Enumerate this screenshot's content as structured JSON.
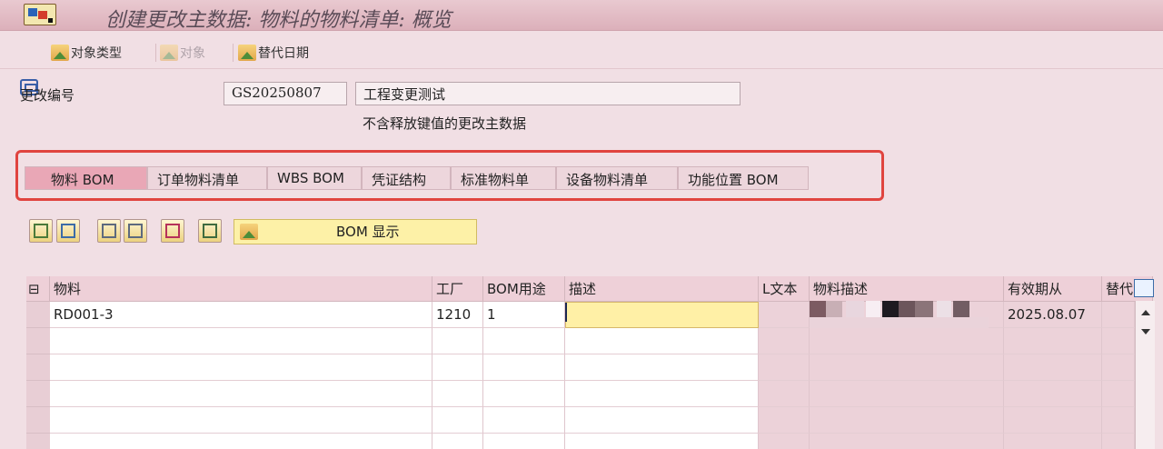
{
  "title_bar": {
    "title": "创建更改主数据: 物料的物料清单: 概览"
  },
  "toolbar": {
    "object_type": "对象类型",
    "object": "对象",
    "substitute_date": "替代日期"
  },
  "change": {
    "label": "更改编号",
    "number": "GS20250807",
    "description": "工程变更测试",
    "note": "不含释放键值的更改主数据"
  },
  "tabs": [
    {
      "label": "物料 BOM",
      "active": true
    },
    {
      "label": "订单物料清单"
    },
    {
      "label": "WBS BOM"
    },
    {
      "label": "凭证结构"
    },
    {
      "label": "标准物料单"
    },
    {
      "label": "设备物料清单"
    },
    {
      "label": "功能位置 BOM"
    }
  ],
  "buttons": {
    "bom_display": "BOM 显示"
  },
  "grid": {
    "headers": [
      "物料",
      "工厂",
      "BOM用途",
      "描述",
      "L文本",
      "物料描述",
      "有效期从",
      "替代"
    ],
    "rows": [
      {
        "material": "RD001-3",
        "plant": "1210",
        "usage": "1",
        "description": "",
        "ltext": "",
        "material_desc": "",
        "valid_from": "2025.08.07",
        "alt": ""
      }
    ]
  },
  "colors": {
    "accent": "#e9a7b6",
    "highlight_box": "#e0443f",
    "edit_field": "#fff0a6"
  },
  "icons": [
    "print-icon",
    "object-type-icon",
    "object-icon",
    "substitute-date-icon",
    "add-row-icon",
    "delete-icon",
    "copy-icon",
    "paste-icon",
    "save-icon",
    "refresh-icon",
    "bom-display-icon",
    "grid-settings-icon"
  ]
}
